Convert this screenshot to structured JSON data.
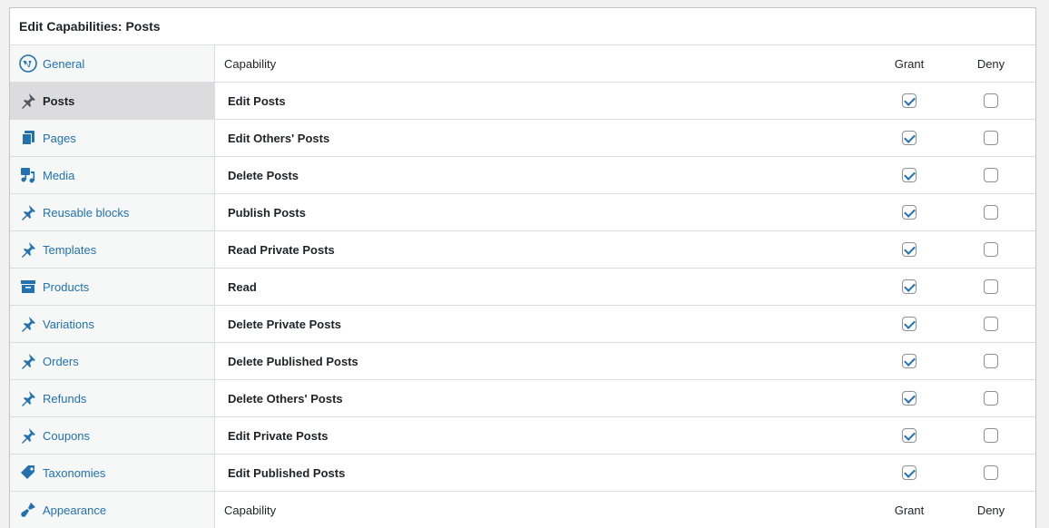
{
  "title": "Edit Capabilities: Posts",
  "sidebar": {
    "items": [
      {
        "label": "General",
        "icon": "wordpress-icon",
        "active": false
      },
      {
        "label": "Posts",
        "icon": "pin-icon",
        "active": true
      },
      {
        "label": "Pages",
        "icon": "pages-icon",
        "active": false
      },
      {
        "label": "Media",
        "icon": "media-icon",
        "active": false
      },
      {
        "label": "Reusable blocks",
        "icon": "pin-icon",
        "active": false
      },
      {
        "label": "Templates",
        "icon": "pin-icon",
        "active": false
      },
      {
        "label": "Products",
        "icon": "archive-icon",
        "active": false
      },
      {
        "label": "Variations",
        "icon": "pin-icon",
        "active": false
      },
      {
        "label": "Orders",
        "icon": "pin-icon",
        "active": false
      },
      {
        "label": "Refunds",
        "icon": "pin-icon",
        "active": false
      },
      {
        "label": "Coupons",
        "icon": "pin-icon",
        "active": false
      },
      {
        "label": "Taxonomies",
        "icon": "tag-icon",
        "active": false
      },
      {
        "label": "Appearance",
        "icon": "brush-icon",
        "active": false
      }
    ]
  },
  "table": {
    "header": {
      "capability": "Capability",
      "grant": "Grant",
      "deny": "Deny"
    },
    "rows": [
      {
        "name": "Edit Posts",
        "grant": true,
        "deny": false
      },
      {
        "name": "Edit Others' Posts",
        "grant": true,
        "deny": false
      },
      {
        "name": "Delete Posts",
        "grant": true,
        "deny": false
      },
      {
        "name": "Publish Posts",
        "grant": true,
        "deny": false
      },
      {
        "name": "Read Private Posts",
        "grant": true,
        "deny": false
      },
      {
        "name": "Read",
        "grant": true,
        "deny": false
      },
      {
        "name": "Delete Private Posts",
        "grant": true,
        "deny": false
      },
      {
        "name": "Delete Published Posts",
        "grant": true,
        "deny": false
      },
      {
        "name": "Delete Others' Posts",
        "grant": true,
        "deny": false
      },
      {
        "name": "Edit Private Posts",
        "grant": true,
        "deny": false
      },
      {
        "name": "Edit Published Posts",
        "grant": true,
        "deny": false
      }
    ],
    "footer": {
      "capability": "Capability",
      "grant": "Grant",
      "deny": "Deny"
    }
  },
  "colors": {
    "link": "#2271b1",
    "active_bg": "#dcdcde",
    "border": "#dcdcde"
  }
}
